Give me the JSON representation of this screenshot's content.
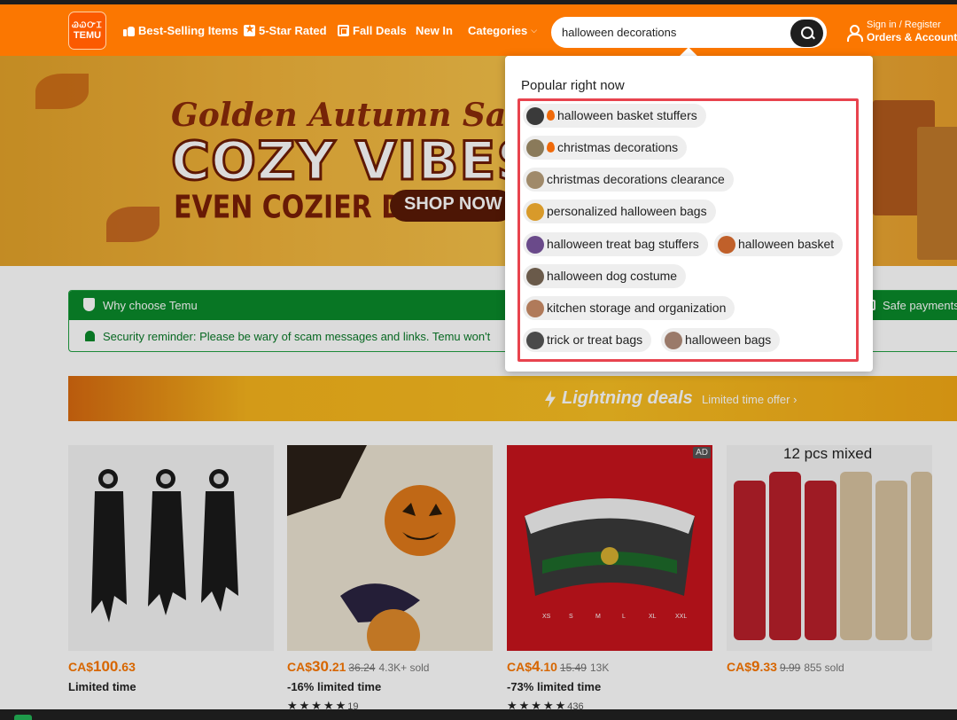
{
  "header": {
    "logo_line1": "ᏊᏇᏅᏆ",
    "logo_line2": "TEMU",
    "nav": [
      "Best-Selling Items",
      "5-Star Rated",
      "Fall Deals",
      "New In",
      "Categories"
    ],
    "search_value": "halloween decorations",
    "signin_line1": "Sign in / Register",
    "signin_line2": "Orders & Account"
  },
  "banner": {
    "line1": "Golden Autumn Sale",
    "line2": "COZY VIBES",
    "line3": "EVEN COZIER DEALS",
    "cta": "SHOP NOW"
  },
  "why": {
    "title": "Why choose Temu",
    "safe": "Safe payments",
    "reminder": "Security reminder: Please be wary of scam messages and links. Temu won't"
  },
  "lightning": {
    "title": "Lightning deals",
    "subtitle": "Limited time offer",
    "chevron": "›"
  },
  "products": [
    {
      "currency": "CA$",
      "price_int": "100",
      "price_dec": ".63",
      "old": "",
      "sold": "",
      "label": "Limited time",
      "stars": "",
      "reviews": ""
    },
    {
      "currency": "CA$",
      "price_int": "30",
      "price_dec": ".21",
      "old": "36.24",
      "sold": "4.3K+ sold",
      "label": "-16% limited time",
      "stars": "★★★★★",
      "reviews": "19"
    },
    {
      "currency": "CA$",
      "price_int": "4",
      "price_dec": ".10",
      "old": "15.49",
      "sold": "13K",
      "label": "-73% limited time",
      "stars": "★★★★★",
      "reviews": "436",
      "ad": "AD"
    },
    {
      "currency": "CA$",
      "price_int": "9",
      "price_dec": ".33",
      "old": "9.99",
      "sold": "855 sold",
      "label": "",
      "stars": "",
      "reviews": "",
      "banner": "12 pcs mixed"
    }
  ],
  "popup": {
    "title": "Popular right now",
    "chips": [
      {
        "label": "halloween basket stuffers",
        "hot": true,
        "thumb_color": "#3a3a3a"
      },
      {
        "label": "christmas decorations",
        "hot": true,
        "thumb_color": "#8a7a5a"
      },
      {
        "label": "christmas decorations clearance",
        "hot": false,
        "thumb_color": "#a08a6a"
      },
      {
        "label": "personalized halloween bags",
        "hot": false,
        "thumb_color": "#d89a2a"
      },
      {
        "label": "halloween treat bag stuffers",
        "hot": false,
        "thumb_color": "#6a4a8a"
      },
      {
        "label": "halloween basket",
        "hot": false,
        "thumb_color": "#c0602a"
      },
      {
        "label": "halloween dog costume",
        "hot": false,
        "thumb_color": "#6a5a4a"
      },
      {
        "label": "kitchen storage and organization",
        "hot": false,
        "thumb_color": "#b07a5a"
      },
      {
        "label": "trick or treat bags",
        "hot": false,
        "thumb_color": "#4a4a4a"
      },
      {
        "label": "halloween bags",
        "hot": false,
        "thumb_color": "#9a7a6a"
      }
    ]
  },
  "colors": {
    "brand": "#fb7701",
    "green": "#0a8a2a",
    "highlight": "#e8434e"
  }
}
